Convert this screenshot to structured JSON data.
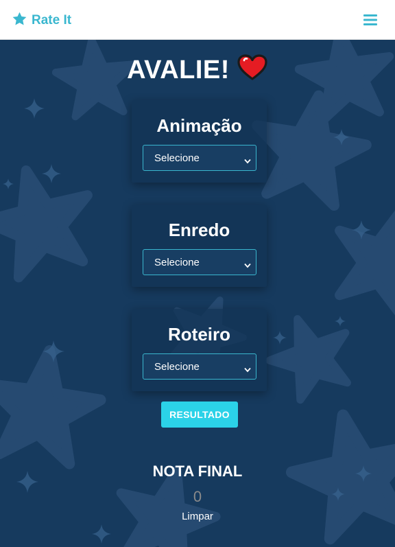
{
  "navbar": {
    "brand_text": "Rate It",
    "brand_icon": "star-icon",
    "menu_icon": "hamburger-menu-icon",
    "accent_color": "#3ab7cf"
  },
  "main": {
    "title": "AVALIE!",
    "title_icon": "red-heart-icon",
    "categories": [
      {
        "label": "Animação",
        "select_value": "Selecione"
      },
      {
        "label": "Enredo",
        "select_value": "Selecione"
      },
      {
        "label": "Roteiro",
        "select_value": "Selecione"
      }
    ],
    "result_button": "RESULTADO",
    "final_title": "NOTA FINAL",
    "final_value": "0",
    "clear_link": "Limpar"
  },
  "colors": {
    "background": "#163a5e",
    "button": "#2bd2e8"
  }
}
